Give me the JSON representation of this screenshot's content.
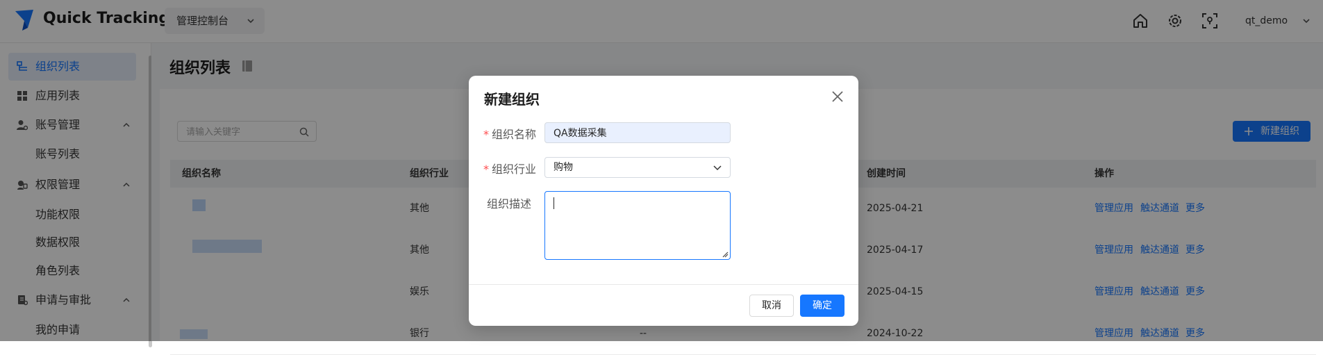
{
  "header": {
    "brand": "Quick Tracking",
    "console_label": "管理控制台",
    "user_name": "qt_demo",
    "icons": [
      "home-icon",
      "settings-icon",
      "scan-icon",
      "chevron-down-icon"
    ]
  },
  "sidebar": {
    "items": [
      {
        "label": "组织列表",
        "icon": "org-list-icon",
        "active": true
      },
      {
        "label": "应用列表",
        "icon": "app-grid-icon"
      },
      {
        "label": "账号管理",
        "icon": "account-icon",
        "expanded": true,
        "children": [
          {
            "label": "账号列表"
          }
        ]
      },
      {
        "label": "权限管理",
        "icon": "permission-icon",
        "expanded": true,
        "children": [
          {
            "label": "功能权限"
          },
          {
            "label": "数据权限"
          },
          {
            "label": "角色列表"
          }
        ]
      },
      {
        "label": "申请与审批",
        "icon": "approval-icon",
        "expanded": true,
        "children": [
          {
            "label": "我的申请"
          }
        ]
      }
    ]
  },
  "page": {
    "title": "组织列表",
    "search_placeholder": "请输入关键字",
    "new_org_label": "新建组织"
  },
  "table": {
    "columns": [
      "组织名称",
      "组织行业",
      "创建时间",
      "操作"
    ],
    "rows": [
      {
        "industry": "其他",
        "created": "2025-04-21"
      },
      {
        "industry": "其他",
        "created": "2025-04-17"
      },
      {
        "industry": "娱乐",
        "created": "2025-04-15"
      },
      {
        "industry": "银行",
        "created": "2024-10-22",
        "extra": "--"
      }
    ],
    "actions": [
      "管理应用",
      "触达通道",
      "更多"
    ]
  },
  "modal": {
    "title": "新建组织",
    "fields": {
      "name_label": "组织名称",
      "name_value": "QA数据采集",
      "industry_label": "组织行业",
      "industry_value": "购物",
      "desc_label": "组织描述",
      "required_mark": "*"
    },
    "cancel_label": "取消",
    "confirm_label": "确定"
  },
  "colors": {
    "primary": "#1677ff",
    "active_bg": "#e6edf9",
    "required": "#ff4d4f",
    "overlay": "rgba(0,0,0,0.45)"
  }
}
